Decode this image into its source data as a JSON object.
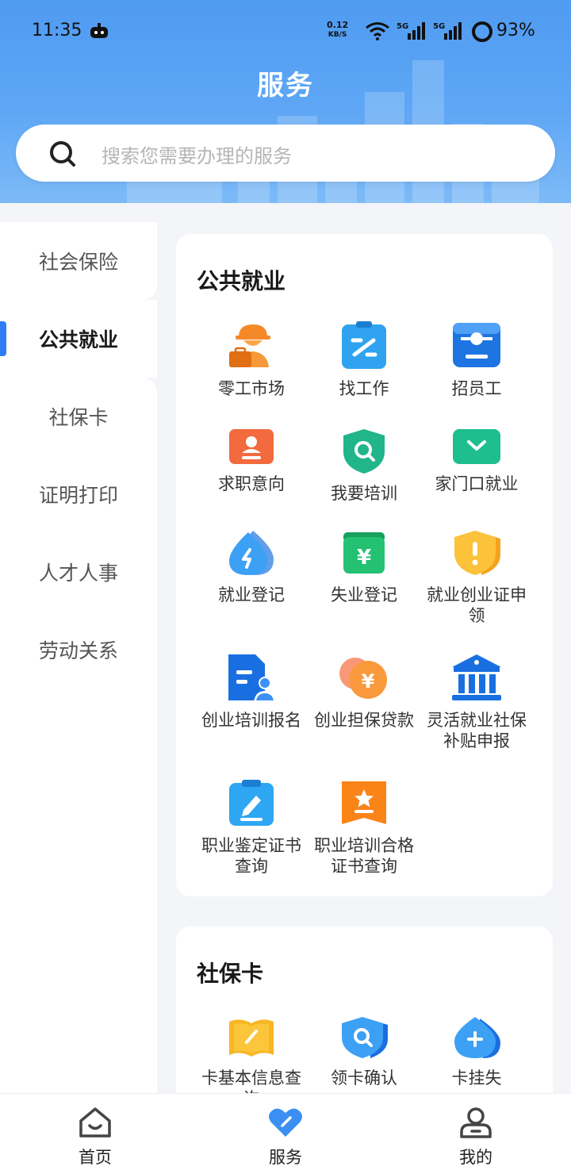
{
  "status": {
    "time": "11:35",
    "net_speed": "0.12",
    "net_unit": "KB/S",
    "battery": "93%"
  },
  "page_title": "服务",
  "search": {
    "placeholder": "搜索您需要办理的服务"
  },
  "sidebar": {
    "items": [
      {
        "label": "社会保险"
      },
      {
        "label": "公共就业"
      },
      {
        "label": "社保卡"
      },
      {
        "label": "证明打印"
      },
      {
        "label": "人才人事"
      },
      {
        "label": "劳动关系"
      }
    ]
  },
  "sections": [
    {
      "title": "公共就业",
      "items": [
        {
          "label": "零工市场",
          "icon": "worker-icon"
        },
        {
          "label": "找工作",
          "icon": "clipboard-icon"
        },
        {
          "label": "招员工",
          "icon": "id-card-icon"
        },
        {
          "label": "求职意向",
          "icon": "resume-icon"
        },
        {
          "label": "我要培训",
          "icon": "shield-search-icon"
        },
        {
          "label": "家门口就业",
          "icon": "chevron-box-icon"
        },
        {
          "label": "就业登记",
          "icon": "drop-icon"
        },
        {
          "label": "失业登记",
          "icon": "wallet-icon"
        },
        {
          "label": "就业创业证申领",
          "icon": "shield-alert-icon"
        },
        {
          "label": "创业培训报名",
          "icon": "document-person-icon"
        },
        {
          "label": "创业担保贷款",
          "icon": "coin-icon"
        },
        {
          "label": "灵活就业社保补贴申报",
          "icon": "bank-icon"
        },
        {
          "label": "职业鉴定证书查询",
          "icon": "clipboard-pen-icon"
        },
        {
          "label": "职业培训合格证书查询",
          "icon": "certificate-star-icon"
        }
      ]
    },
    {
      "title": "社保卡",
      "items": [
        {
          "label": "卡基本信息查询",
          "icon": "book-pen-icon"
        },
        {
          "label": "领卡确认",
          "icon": "shield-search-icon"
        },
        {
          "label": "卡挂失",
          "icon": "drop-plus-icon"
        }
      ]
    }
  ],
  "tabbar": {
    "items": [
      {
        "label": "首页",
        "icon": "home-icon"
      },
      {
        "label": "服务",
        "icon": "heart-icon"
      },
      {
        "label": "我的",
        "icon": "profile-icon"
      }
    ]
  },
  "colors": {
    "accent": "#2f7cf6",
    "header": "#5fa7f5"
  }
}
